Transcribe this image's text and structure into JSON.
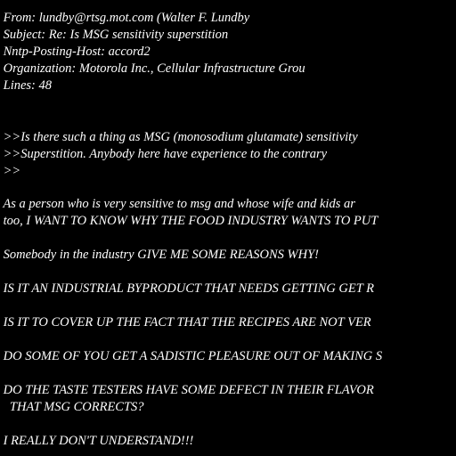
{
  "header": {
    "from": " From: lundby@rtsg.mot.com (Walter F. Lundby",
    "subject": " Subject: Re: Is MSG sensitivity superstition",
    "posting_host": " Nntp-Posting-Host: accord2",
    "organization": " Organization: Motorola Inc., Cellular Infrastructure Grou",
    "lines": " Lines: 48"
  },
  "quoted": [
    " >>Is there such a thing as MSG (monosodium glutamate) sensitivity",
    " >>Superstition. Anybody here have experience to the contrary",
    " >>"
  ],
  "body": [
    " As a person who is very sensitive to msg and whose wife and kids ar",
    " too, I WANT TO KNOW WHY THE FOOD INDUSTRY WANTS TO PUT",
    " Somebody in the industry GIVE ME SOME REASONS WHY!",
    " IS IT AN INDUSTRIAL BYPRODUCT THAT NEEDS GETTING GET R",
    " IS IT TO COVER UP THE FACT THAT THE RECIPES ARE NOT VER",
    " DO SOME OF YOU GET A SADISTIC PLEASURE OUT OF MAKING S",
    " DO THE TASTE TESTERS HAVE SOME DEFECT IN THEIR FLAVOR",
    "   THAT MSG CORRECTS?",
    " I REALLY DON'T UNDERSTAND!!!"
  ]
}
